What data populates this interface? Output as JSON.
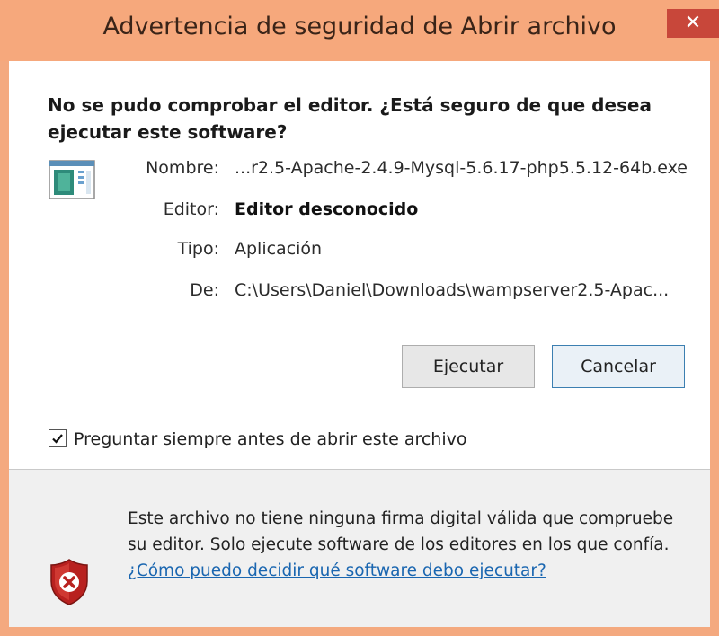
{
  "window": {
    "title": "Advertencia de seguridad de Abrir archivo",
    "close_glyph": "✕"
  },
  "question": "No se pudo comprobar el editor. ¿Está seguro de que desea ejecutar este software?",
  "file_icon": "application-file-icon",
  "details": {
    "name_label": "Nombre:",
    "name_value": "...r2.5-Apache-2.4.9-Mysql-5.6.17-php5.5.12-64b.exe",
    "editor_label": "Editor:",
    "editor_value": "Editor desconocido",
    "type_label": "Tipo:",
    "type_value": "Aplicación",
    "from_label": "De:",
    "from_value": "C:\\Users\\Daniel\\Downloads\\wampserver2.5-Apac..."
  },
  "buttons": {
    "run": "Ejecutar",
    "cancel": "Cancelar"
  },
  "always_ask": {
    "checked": true,
    "label": "Preguntar siempre antes de abrir este archivo"
  },
  "warning": {
    "icon": "shield-error-icon",
    "text": "Este archivo no tiene ninguna firma digital válida que compruebe su editor. Solo ejecute software de los editores en los que confía.",
    "link": "¿Cómo puedo decidir qué software debo ejecutar?"
  },
  "colors": {
    "titlebar": "#f6a87c",
    "close_button": "#c8473a",
    "link": "#1a66b0",
    "lower_panel": "#f0f0f0"
  }
}
